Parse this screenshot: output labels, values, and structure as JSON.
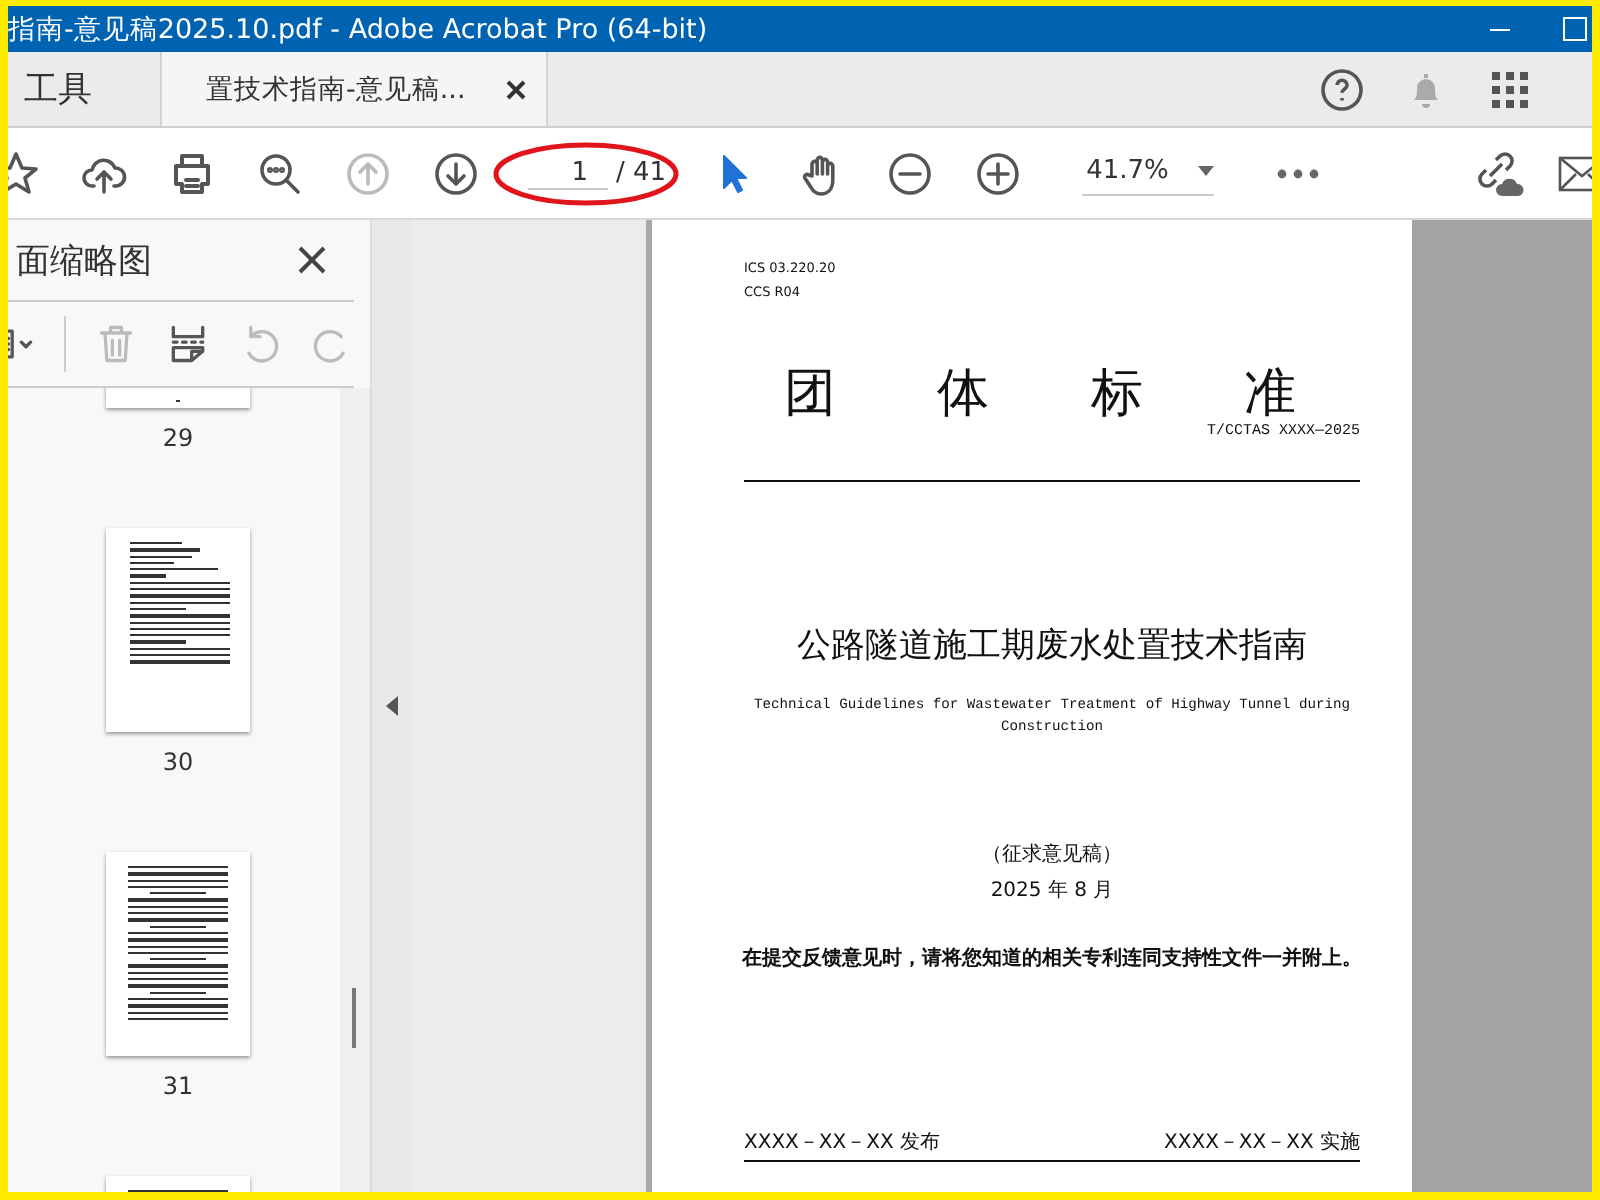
{
  "window": {
    "title": "指南-意见稿2025.10.pdf - Adobe Acrobat Pro (64-bit)"
  },
  "tabs": [
    {
      "label": "工具",
      "selected": false,
      "closable": false
    },
    {
      "label": "置技术指南-意见稿...",
      "selected": true,
      "closable": true
    }
  ],
  "toolbar": {
    "tools": [
      {
        "kind": "star",
        "disabled": false
      },
      {
        "kind": "upload",
        "disabled": false
      },
      {
        "kind": "print",
        "disabled": false
      },
      {
        "kind": "zoom",
        "disabled": false
      },
      {
        "kind": "prev",
        "disabled": true
      },
      {
        "kind": "next",
        "disabled": false
      }
    ],
    "page_number": "1",
    "page_total": "/ 41",
    "tools2": [
      {
        "kind": "pointer",
        "disabled": false
      },
      {
        "kind": "hand",
        "disabled": false
      },
      {
        "kind": "minus",
        "disabled": false
      },
      {
        "kind": "plus",
        "disabled": false
      }
    ],
    "zoom": "41.7%"
  },
  "sidebar": {
    "title": "面缩略图",
    "tools": [
      {
        "kind": "options",
        "disabled": false
      },
      {
        "kind": "delete",
        "disabled": true
      },
      {
        "kind": "insert",
        "disabled": false
      },
      {
        "kind": "undo",
        "disabled": true
      },
      {
        "kind": "redo",
        "disabled": true
      }
    ],
    "thumbnails": [
      {
        "label": "29",
        "kind": "tail"
      },
      {
        "label": "30",
        "kind": "sparse"
      },
      {
        "label": "31",
        "kind": "dense"
      },
      {
        "kind": "dense_top"
      }
    ]
  },
  "document": {
    "meta_lines": [
      "ICS 03.220.20",
      "CCS R04"
    ],
    "heading": "团体标准",
    "code": "T/CCTAS XXXX—2025",
    "title": "公路隧道施工期废水处置技术指南",
    "title_en": "Technical Guidelines for Wastewater Treatment of Highway Tunnel during Construction",
    "draft": "（征求意见稿）",
    "date": "2025 年 8 月",
    "notice": "在提交反馈意见时，请将您知道的相关专利连同支持性文件一并附上。",
    "published": "XXXX－XX－XX 发布",
    "implemented": "XXXX－XX－XX 实施"
  }
}
